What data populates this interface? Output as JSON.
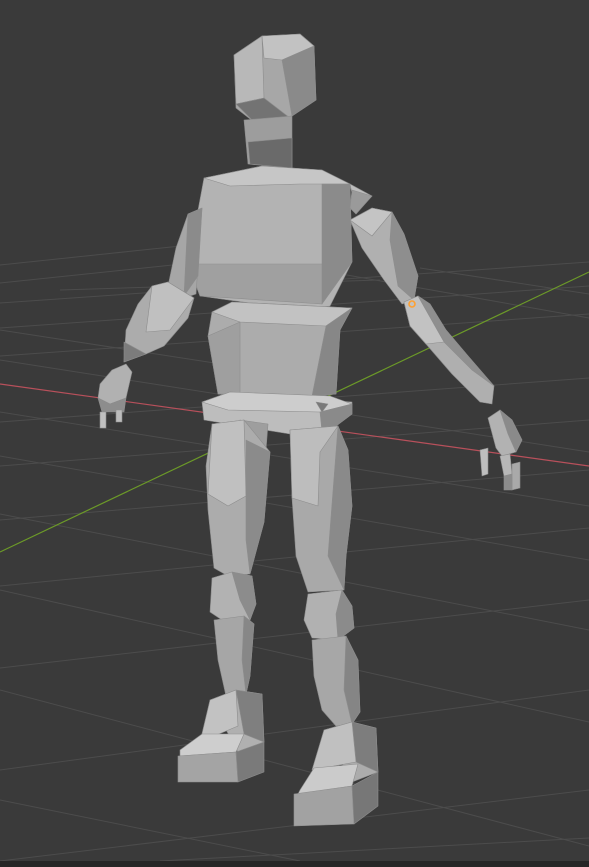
{
  "viewport": {
    "background": "#3a3a3a",
    "grid_color": "#4a4a4a",
    "x_axis_color": "#b8505b",
    "y_axis_color": "#6c9a28"
  },
  "model": {
    "face_light": "#b9b9b9",
    "face_mid": "#a3a3a3",
    "face_dark": "#7d7d7d",
    "face_shadow": "#5e5e5e",
    "selected_vertex_color": "#ffa030"
  }
}
